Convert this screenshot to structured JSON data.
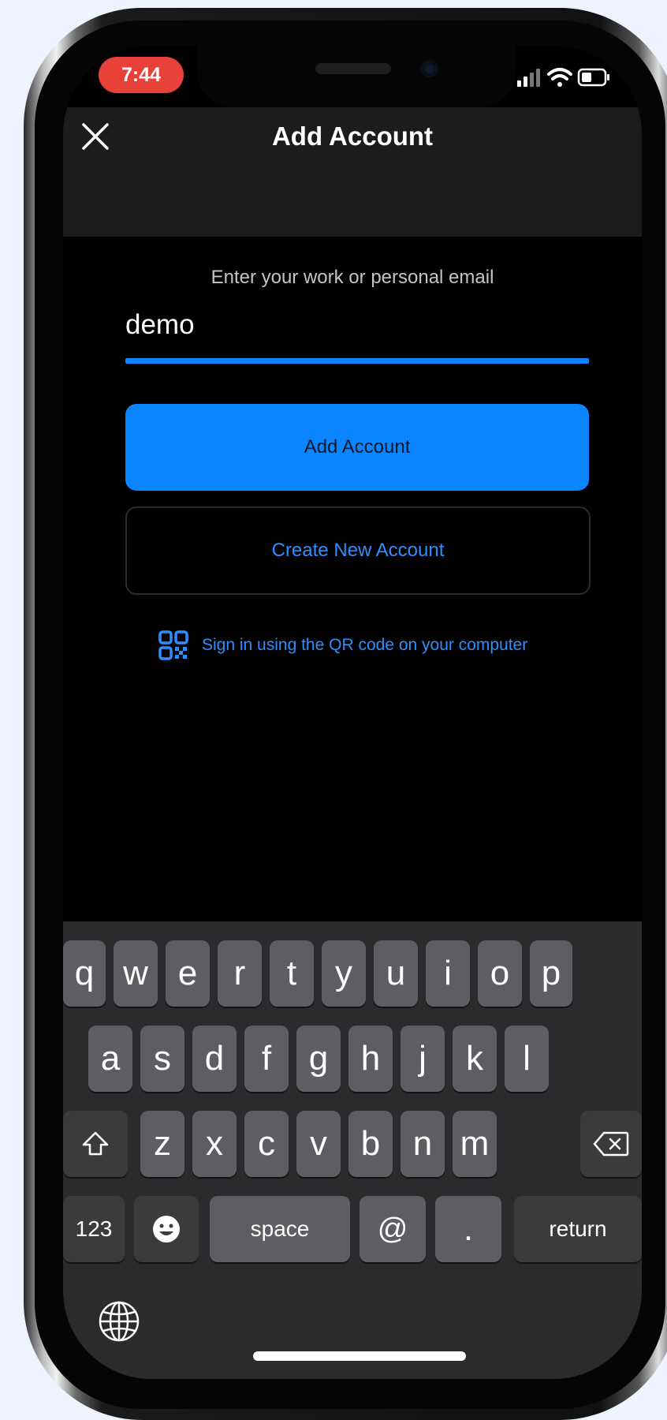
{
  "status_bar": {
    "time": "7:44",
    "time_pill_color": "#e8413a"
  },
  "header": {
    "title": "Add Account",
    "close_icon": "close-icon"
  },
  "main": {
    "prompt": "Enter your work or personal email",
    "email_value": "demo",
    "add_account_label": "Add Account",
    "create_account_label": "Create New Account",
    "qr_signin_label": "Sign in using the QR code on your computer"
  },
  "colors": {
    "accent": "#0a84ff",
    "link": "#2d8fff"
  },
  "keyboard": {
    "row1": [
      "q",
      "w",
      "e",
      "r",
      "t",
      "y",
      "u",
      "i",
      "o",
      "p"
    ],
    "row2": [
      "a",
      "s",
      "d",
      "f",
      "g",
      "h",
      "j",
      "k",
      "l"
    ],
    "row3": [
      "z",
      "x",
      "c",
      "v",
      "b",
      "n",
      "m"
    ],
    "numbers": "123",
    "space": "space",
    "at": "@",
    "dot": ".",
    "return": "return"
  }
}
